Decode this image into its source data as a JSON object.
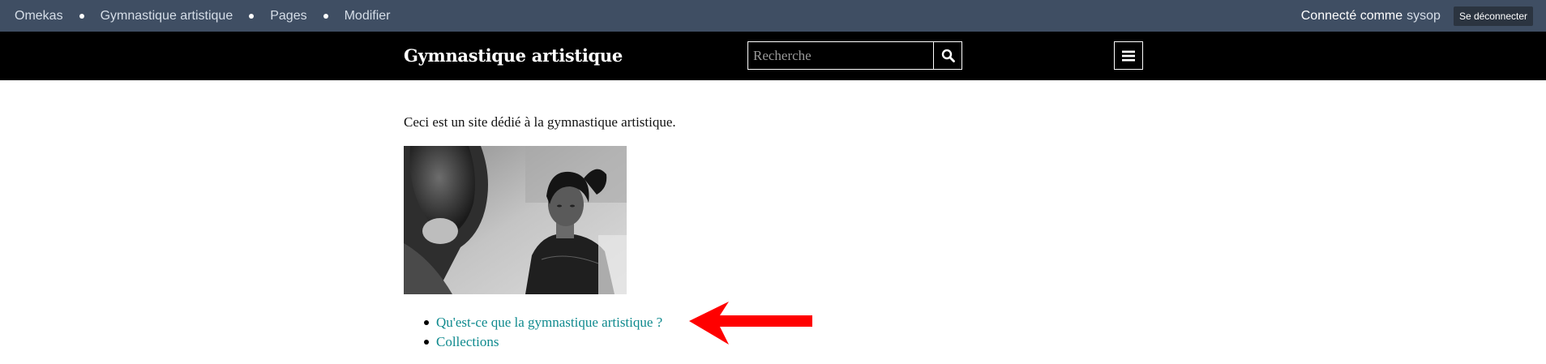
{
  "admin_bar": {
    "breadcrumbs": [
      "Omekas",
      "Gymnastique artistique",
      "Pages",
      "Modifier"
    ],
    "connected_label": "Connecté comme",
    "username": "sysop",
    "logout_label": "Se déconnecter"
  },
  "site": {
    "title": "Gymnastique artistique",
    "search_placeholder": "Recherche"
  },
  "page": {
    "intro": "Ceci est un site dédié à la gymnastique artistique.",
    "links": [
      "Qu'est-ce que la gymnastique artistique ?",
      "Collections"
    ]
  },
  "colors": {
    "admin_bar_bg": "#3f4e63",
    "header_bg": "#000000",
    "link": "#0f8a8e",
    "annotation_arrow": "#ff0000"
  },
  "icons": {
    "search": "search-icon",
    "menu": "menu-icon"
  }
}
